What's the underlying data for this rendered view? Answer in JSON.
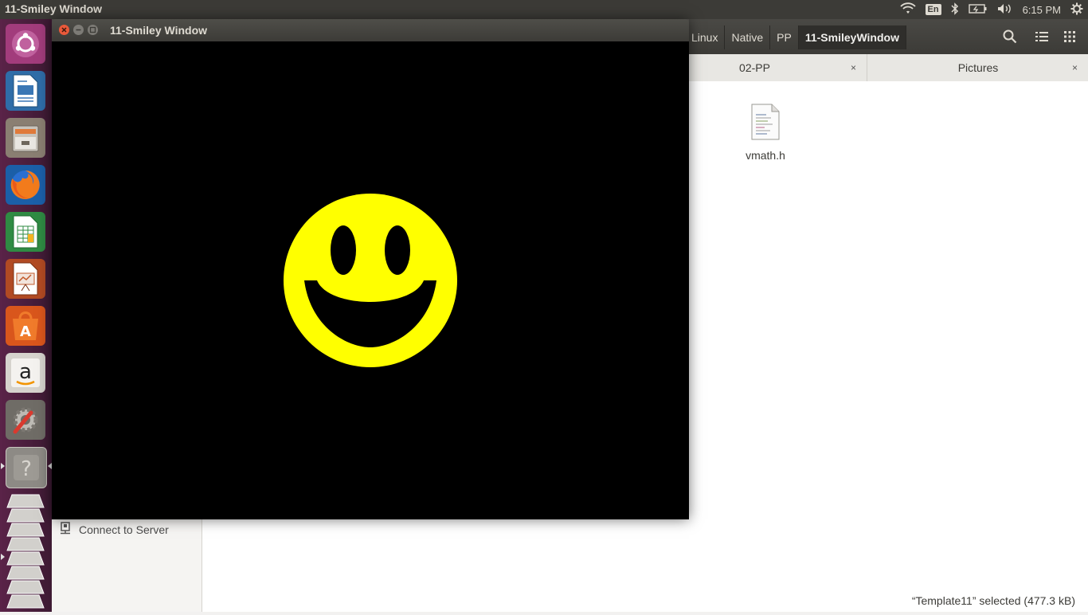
{
  "topbar": {
    "title": "11-Smiley Window",
    "lang": "En",
    "time": "6:15 PM"
  },
  "launcher": {
    "items": [
      "ubuntu-dash",
      "libreoffice-writer",
      "file-manager",
      "firefox",
      "libreoffice-calc",
      "libreoffice-impress",
      "ubuntu-software",
      "amazon",
      "system-settings",
      "help",
      "workspaces"
    ]
  },
  "filemanager": {
    "breadcrumbs": [
      "Linux",
      "Native",
      "PP",
      "11-SmileyWindow"
    ],
    "tabs": [
      {
        "label": "02-PP",
        "close": "×"
      },
      {
        "label": "Pictures",
        "close": "×"
      }
    ],
    "sidebar": {
      "connect": "Connect to Server"
    },
    "files": [
      {
        "name": "vmath.h"
      }
    ],
    "status": "“Template11” selected  (477.3 kB)"
  },
  "app_window": {
    "title": "11-Smiley Window",
    "colors": {
      "background": "#000000",
      "face": "#ffff00"
    }
  }
}
